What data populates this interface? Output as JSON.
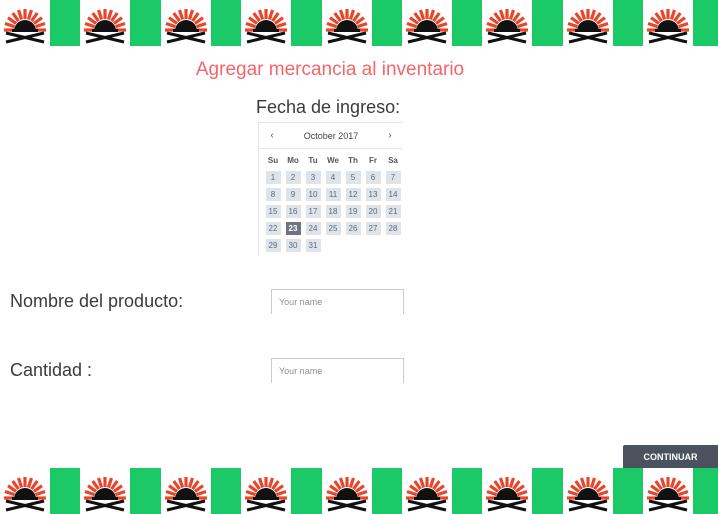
{
  "colors": {
    "banner_green": "#1bc966",
    "title": "#f4646a",
    "button": "#4a525d",
    "logo_red": "#e8452a"
  },
  "banner": {
    "tile_icon": "sunburst-logo-icon",
    "tiles": 9
  },
  "form": {
    "title": "Agregar mercancia al inventario",
    "date_label": "Fecha de ingreso:",
    "name_label": "Nombre del producto:",
    "name_placeholder": "Your name",
    "quantity_label": "Cantidad :",
    "quantity_placeholder": "Your name",
    "continue_label": "CONTINUAR"
  },
  "calendar": {
    "month": "October 2017",
    "prev": "‹",
    "next": "›",
    "weekdays": [
      "Su",
      "Mo",
      "Tu",
      "We",
      "Th",
      "Fr",
      "Sa"
    ],
    "days": [
      "1",
      "2",
      "3",
      "4",
      "5",
      "6",
      "7",
      "8",
      "9",
      "10",
      "11",
      "12",
      "13",
      "14",
      "15",
      "16",
      "17",
      "18",
      "19",
      "20",
      "21",
      "22",
      "23",
      "24",
      "25",
      "26",
      "27",
      "28",
      "29",
      "30",
      "31"
    ],
    "selected": "23"
  }
}
